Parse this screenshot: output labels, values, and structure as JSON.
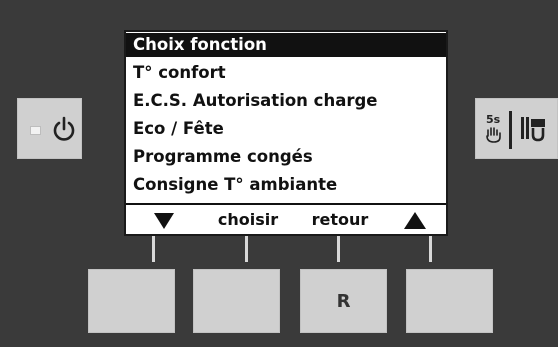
{
  "menu": {
    "title": "Choix fonction",
    "items": [
      "T° confort",
      "E.C.S. Autorisation charge",
      "Eco / Fête",
      "Programme congés",
      "Consigne T° ambiante"
    ]
  },
  "softkeys": {
    "down": "arrow-down",
    "choose": "choisir",
    "back": "retour",
    "up": "arrow-up"
  },
  "buttons": {
    "reset_label": "R"
  },
  "service": {
    "hold_label": "5s"
  },
  "colors": {
    "panel": "#3a3a3a",
    "button": "#d0d0d0",
    "screen": "#ffffff",
    "selection": "#111111"
  }
}
